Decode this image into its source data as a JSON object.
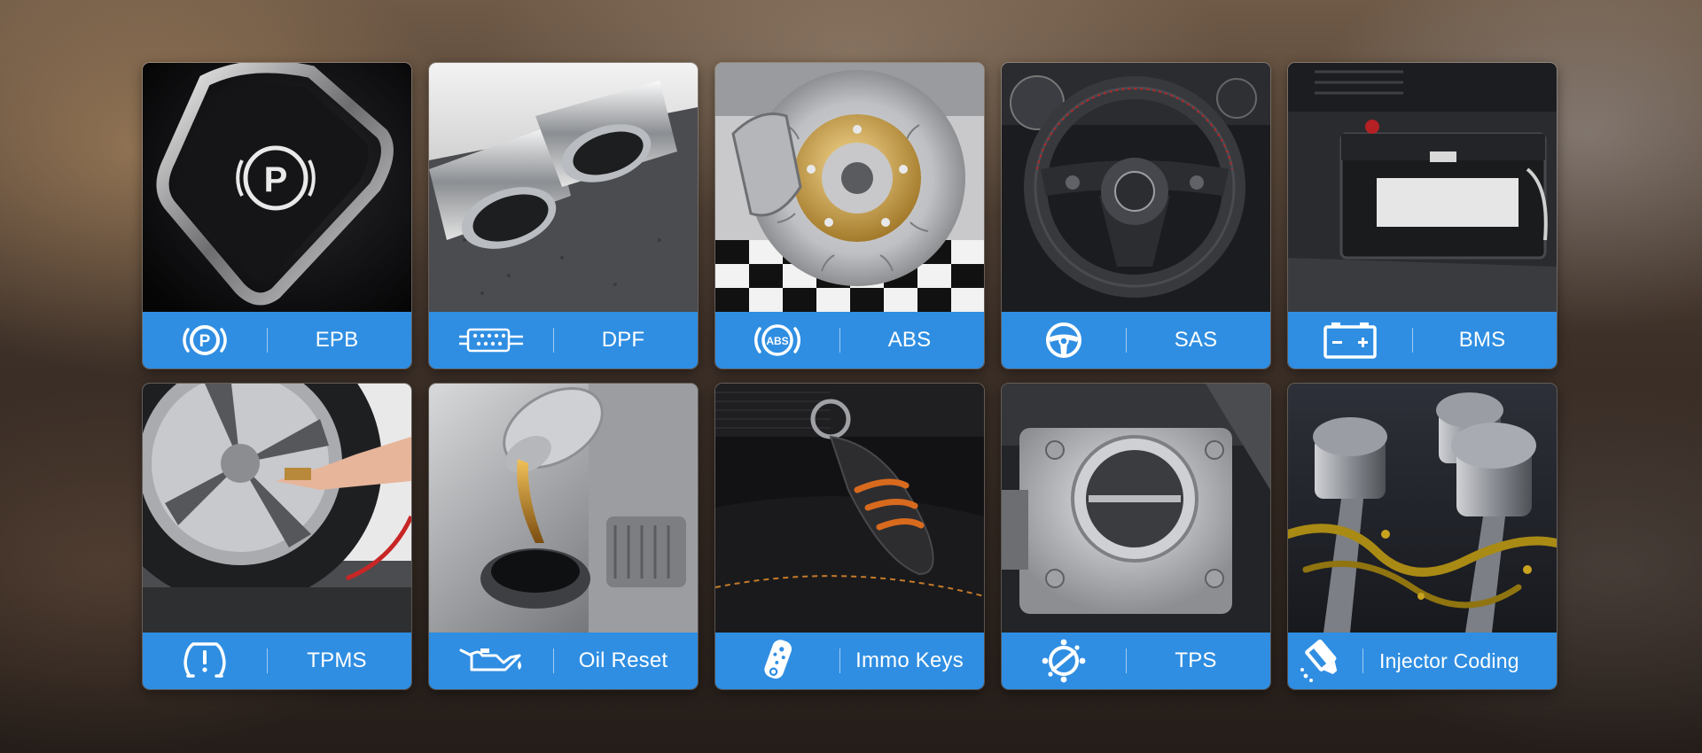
{
  "features": [
    {
      "id": "epb",
      "label": "EPB",
      "icon": "parking-brake-icon"
    },
    {
      "id": "dpf",
      "label": "DPF",
      "icon": "particulate-filter-icon"
    },
    {
      "id": "abs",
      "label": "ABS",
      "icon": "abs-icon"
    },
    {
      "id": "sas",
      "label": "SAS",
      "icon": "steering-wheel-icon"
    },
    {
      "id": "bms",
      "label": "BMS",
      "icon": "battery-icon"
    },
    {
      "id": "tpms",
      "label": "TPMS",
      "icon": "tire-pressure-icon"
    },
    {
      "id": "oil",
      "label": "Oil Reset",
      "icon": "oil-can-icon"
    },
    {
      "id": "immo",
      "label": "Immo Keys",
      "icon": "key-fob-icon"
    },
    {
      "id": "tps",
      "label": "TPS",
      "icon": "throttle-icon"
    },
    {
      "id": "injector",
      "label": "Injector Coding",
      "icon": "injector-icon"
    }
  ],
  "icon_text": {
    "epb": "P",
    "abs": "ABS"
  },
  "colors": {
    "label_bar": "#2f8ee2",
    "label_text": "#ffffff"
  }
}
